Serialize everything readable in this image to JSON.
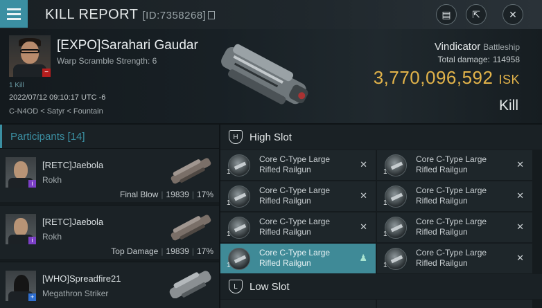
{
  "app": {
    "title": "KILL REPORT",
    "id_label": "[ID:7358268]",
    "buttons": [
      {
        "name": "report-icon",
        "glyph": "▤"
      },
      {
        "name": "share-icon",
        "glyph": "⇱"
      },
      {
        "name": "close-icon",
        "glyph": "✕"
      }
    ]
  },
  "victim": {
    "name": "[EXPO]Sarahari Gaudar",
    "warp_scramble": "Warp Scramble Strength: 6",
    "kill_count": "1 Kill",
    "datetime": "2022/07/12 09:10:17 UTC -6",
    "location": "C-N4OD < Satyr < Fountain",
    "ship_name": "Vindicator",
    "ship_class": "Battleship",
    "damage_label": "Total damage:",
    "damage_value": "114958",
    "isk_value": "3,770,096,592",
    "isk_unit": "ISK",
    "result": "Kill"
  },
  "participants": {
    "label": "Participants",
    "count": "[14]",
    "items": [
      {
        "name": "[RETC]Jaebola",
        "ship": "Rokh",
        "role": "Final Blow",
        "damage": "19839",
        "percent": "17%"
      },
      {
        "name": "[RETC]Jaebola",
        "ship": "Rokh",
        "role": "Top Damage",
        "damage": "19839",
        "percent": "17%"
      },
      {
        "name": "[WHO]Spreadfire21",
        "ship": "Megathron Striker",
        "role": "",
        "damage": "",
        "percent": ""
      }
    ]
  },
  "fitting": {
    "high_slot_label": "High Slot",
    "low_slot_label": "Low Slot",
    "high_slot": [
      {
        "line1": "Core C-Type Large",
        "line2": "Rifled Railgun",
        "qty": "1",
        "action": "✕"
      },
      {
        "line1": "Core C-Type Large",
        "line2": "Rifled Railgun",
        "qty": "1",
        "action": "✕"
      },
      {
        "line1": "Core C-Type Large",
        "line2": "Rifled Railgun",
        "qty": "1",
        "action": "✕"
      },
      {
        "line1": "Core C-Type Large",
        "line2": "Rifled Railgun",
        "qty": "1",
        "action": "✕"
      },
      {
        "line1": "Core C-Type Large",
        "line2": "Rifled Railgun",
        "qty": "1",
        "action": "✕"
      },
      {
        "line1": "Core C-Type Large",
        "line2": "Rifled Railgun",
        "qty": "1",
        "action": "✕"
      },
      {
        "line1": "Core C-Type Large",
        "line2": "Rifled Railgun",
        "qty": "1",
        "action": "♟"
      },
      {
        "line1": "Core C-Type Large",
        "line2": "Rifled Railgun",
        "qty": "1",
        "action": "✕"
      }
    ]
  }
}
